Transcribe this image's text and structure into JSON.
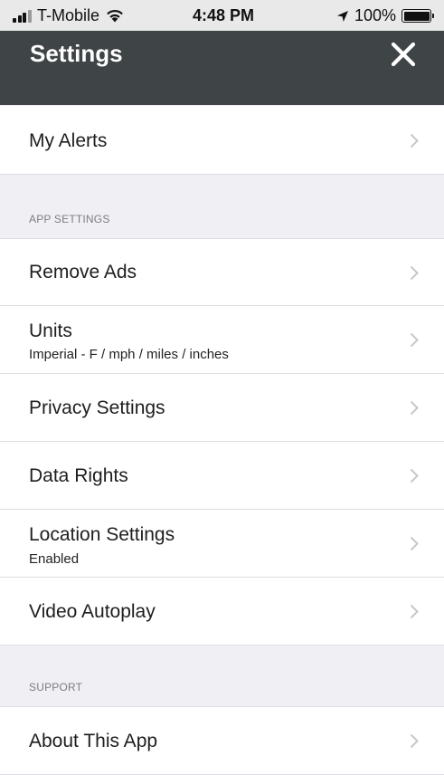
{
  "status_bar": {
    "carrier": "T-Mobile",
    "time": "4:48 PM",
    "battery": "100%",
    "icons": [
      "signal-icon",
      "wifi-icon",
      "location-arrow-icon",
      "battery-icon"
    ]
  },
  "header": {
    "title": "Settings",
    "close_icon": "close-icon"
  },
  "items": {
    "my_alerts": {
      "label": "My Alerts"
    },
    "remove_ads": {
      "label": "Remove Ads"
    },
    "units": {
      "label": "Units",
      "sub": "Imperial - F / mph / miles / inches"
    },
    "privacy": {
      "label": "Privacy Settings"
    },
    "data_rights": {
      "label": "Data Rights"
    },
    "location": {
      "label": "Location Settings",
      "sub": "Enabled"
    },
    "video_autoplay": {
      "label": "Video Autoplay"
    },
    "about": {
      "label": "About This App"
    }
  },
  "sections": {
    "app_settings": "APP SETTINGS",
    "support": "SUPPORT"
  },
  "colors": {
    "header_bg": "#3f4447",
    "page_bg": "#efeff4",
    "chevron": "#c7c7cc"
  }
}
